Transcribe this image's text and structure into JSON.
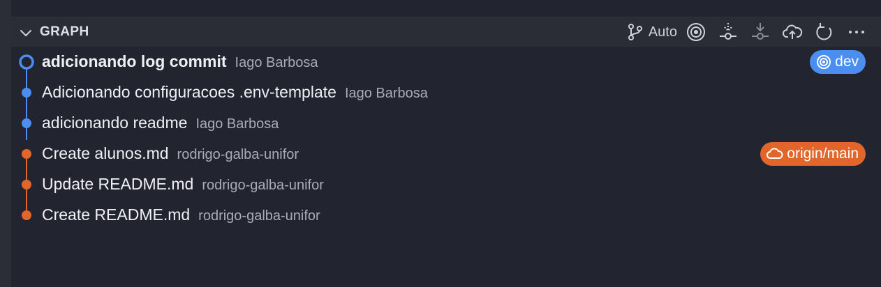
{
  "panel": {
    "title": "GRAPH",
    "toolbar": {
      "auto_label": "Auto",
      "icons": [
        "branch-icon",
        "target-icon",
        "fetch-icon",
        "pull-icon",
        "cloud-upload-icon",
        "refresh-icon",
        "more-icon"
      ]
    }
  },
  "commits": [
    {
      "message": "adicionando log commit",
      "author": "Iago Barbosa",
      "bold": true,
      "lane_color": "#4c8ef0",
      "badge": "dev"
    },
    {
      "message": "Adicionando configuracoes .env-template",
      "author": "Iago Barbosa",
      "lane_color": "#4c8ef0"
    },
    {
      "message": "adicionando readme",
      "author": "Iago Barbosa",
      "lane_color": "#4c8ef0"
    },
    {
      "message": "Create alunos.md",
      "author": "rodrigo-galba-unifor",
      "lane_color": "#e0662b",
      "badge": "origin/main"
    },
    {
      "message": "Update README.md",
      "author": "rodrigo-galba-unifor",
      "lane_color": "#e0662b"
    },
    {
      "message": "Create README.md",
      "author": "rodrigo-galba-unifor",
      "lane_color": "#e0662b"
    }
  ],
  "badges": {
    "dev": {
      "label": "dev",
      "color": "#4c8ef0",
      "icon": "target-icon"
    },
    "origin_main": {
      "label": "origin/main",
      "color": "#e0662b",
      "icon": "cloud-icon"
    }
  }
}
